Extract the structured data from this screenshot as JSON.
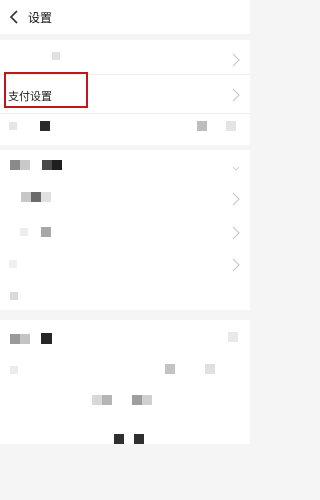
{
  "header": {
    "title": "设置",
    "back_icon": "chevron-left-icon"
  },
  "settings": {
    "payment_settings_label": "支付设置"
  },
  "colors": {
    "highlight_border": "#c0161c",
    "page_background": "#f5f5f5",
    "section_background": "#ffffff"
  }
}
